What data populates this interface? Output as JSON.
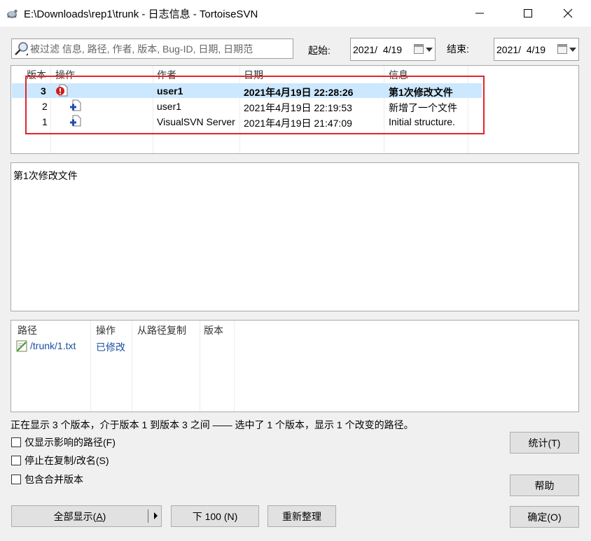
{
  "window": {
    "title": "E:\\Downloads\\rep1\\trunk - 日志信息 - TortoiseSVN"
  },
  "filter": {
    "search_placeholder": "被过滤 信息, 路径, 作者, 版本, Bug-ID, 日期, 日期范",
    "start_label": "起始:",
    "start_date": "2021/  4/19",
    "end_label": "结束:",
    "end_date": "2021/  4/19"
  },
  "revisions": {
    "columns": [
      "版本",
      "操作",
      "作者",
      "日期",
      "信息"
    ],
    "rows": [
      {
        "rev": "3",
        "action_icon": "modified-error-icon",
        "author": "user1",
        "date": "2021年4月19日 22:28:26",
        "message": "第1次修改文件",
        "selected": true
      },
      {
        "rev": "2",
        "action_icon": "added-file-icon",
        "author": "user1",
        "date": "2021年4月19日 22:19:53",
        "message": "新增了一个文件",
        "selected": false
      },
      {
        "rev": "1",
        "action_icon": "added-file-icon",
        "author": "VisualSVN Server",
        "date": "2021年4月19日 21:47:09",
        "message": "Initial structure.",
        "selected": false
      }
    ]
  },
  "message_pane": {
    "text": "第1次修改文件"
  },
  "changed_paths": {
    "columns": [
      "路径",
      "操作",
      "从路径复制",
      "版本"
    ],
    "rows": [
      {
        "path": "/trunk/1.txt",
        "action": "已修改",
        "icon": "text-file-icon"
      }
    ]
  },
  "status": {
    "text": "正在显示 3 个版本，介于版本 1 到版本 3 之间 —— 选中了 1 个版本，显示 1 个改变的路径。"
  },
  "options": {
    "affected_paths_only": "仅显示影响的路径(F)",
    "stop_on_copy": "停止在复制/改名(S)",
    "include_merged": "包含合并版本"
  },
  "buttons": {
    "stats": "统计(T)",
    "help": "帮助",
    "ok": "确定(O)",
    "show_all": "全部显示(",
    "show_all_key": "A",
    "show_all_end": ")",
    "next_100": "下 100 (N)",
    "refresh": "重新整理"
  },
  "colors": {
    "selection": "#cce8ff",
    "highlight_frame": "#e0252b",
    "path_text": "#1a4fa0"
  }
}
